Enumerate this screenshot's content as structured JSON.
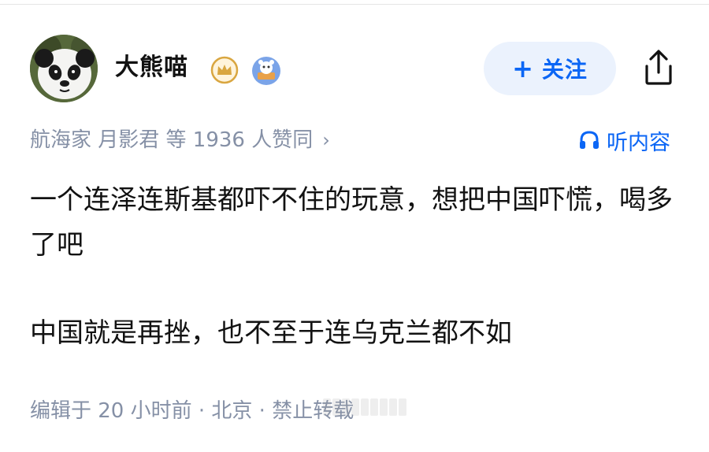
{
  "author": {
    "name": "大熊喵",
    "avatar_icon": "panda-avatar",
    "badges": [
      "crown-badge-icon",
      "tinker-badge-icon"
    ]
  },
  "header": {
    "follow_plus": "+",
    "follow_label": "关注",
    "share_icon": "share-icon"
  },
  "meta": {
    "votes_text": "航海家 月影君 等 1936 人赞同",
    "votes_chevron": "›",
    "listen_label": "听内容",
    "listen_icon": "headphones-icon"
  },
  "answer": {
    "paragraphs": [
      "一个连泽连斯基都吓不住的玩意，想把中国吓慌，喝多了吧",
      "中国就是再挫，也不至于连乌克兰都不如"
    ]
  },
  "footer": {
    "edit_meta": "编辑于 20 小时前 · 北京 · 禁止转载"
  },
  "colors": {
    "accent": "#0b66f5",
    "follow_bg": "#ebf2fd",
    "meta_gray": "#8590a6",
    "text": "#121212"
  }
}
